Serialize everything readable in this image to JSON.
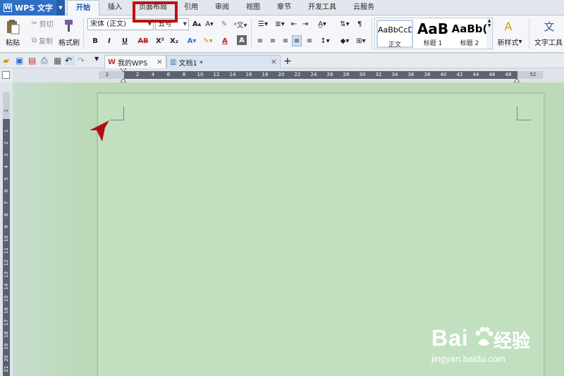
{
  "app": {
    "name": "WPS 文字"
  },
  "menu_tabs": [
    "开始",
    "插入",
    "页面布局",
    "引用",
    "审阅",
    "视图",
    "章节",
    "开发工具",
    "云服务"
  ],
  "active_tab": "开始",
  "highlighted_tab": "页面布局",
  "ribbon": {
    "clipboard": {
      "paste": "粘贴",
      "cut": "剪切",
      "copy": "复制",
      "format_painter": "格式刷"
    },
    "font": {
      "family": "宋体 (正文)",
      "size": "五号"
    },
    "styles": [
      {
        "sample": "AaBbCcD",
        "name": "正文"
      },
      {
        "sample": "AaB",
        "name": "标题 1"
      },
      {
        "sample": "AaBb(",
        "name": "标题 2"
      }
    ],
    "new_style": "新样式",
    "text_tools": "文字工具",
    "font_buttons": {
      "bold": "B",
      "italic": "I",
      "underline": "U",
      "strike": "AB",
      "superscript": "X²",
      "subscript": "X₂",
      "font_color": "A",
      "char_shading": "A"
    }
  },
  "doc_tabs": [
    {
      "label": "我的WPS"
    },
    {
      "label": "文档1 *"
    }
  ],
  "new_tab_label": "+",
  "ruler": {
    "horizontal": [
      "2",
      "2",
      "4",
      "6",
      "8",
      "10",
      "12",
      "14",
      "16",
      "18",
      "20",
      "22",
      "24",
      "26",
      "28",
      "30",
      "32",
      "34",
      "36",
      "38",
      "40",
      "42",
      "44",
      "46",
      "48",
      "52"
    ],
    "vertical": [
      "1",
      "1",
      "2",
      "3",
      "4",
      "5",
      "6",
      "7",
      "8",
      "9",
      "10",
      "11",
      "12",
      "13",
      "14",
      "15",
      "16",
      "17",
      "18",
      "19",
      "20",
      "21"
    ]
  },
  "watermark": {
    "brand": "Bai",
    "brand_cn": "经验",
    "url": "jingyan.baidu.com"
  },
  "colors": {
    "app_blue": "#2f6fc4",
    "highlight_red": "#c0100f",
    "page_green": "#c2e0c0"
  }
}
